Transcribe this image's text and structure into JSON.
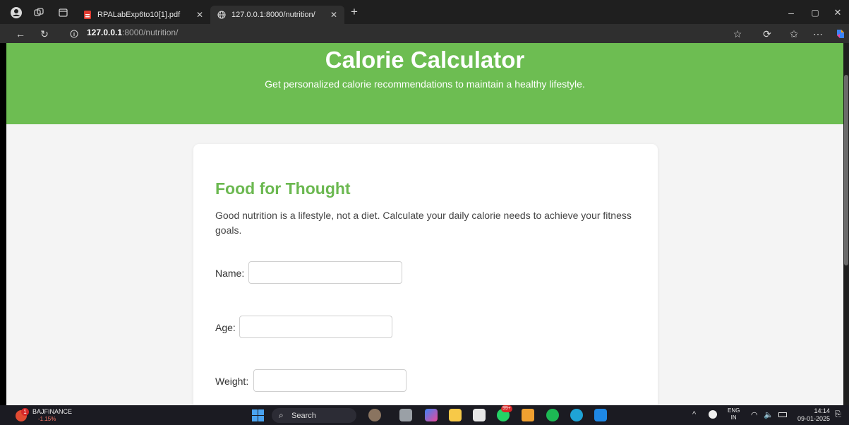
{
  "browser": {
    "tabs": [
      {
        "title": "RPALabExp6to10[1].pdf"
      },
      {
        "title": "127.0.0.1:8000/nutrition/"
      }
    ],
    "new_tab": "+",
    "url_host": "127.0.0.1",
    "url_path": ":8000/nutrition/",
    "window_controls": {
      "minimize": "–",
      "restore": "▢",
      "close": "✕"
    }
  },
  "page": {
    "header_title": "Calorie Calculator",
    "header_subtitle": "Get personalized calorie recommendations to maintain a healthy lifestyle.",
    "card_title": "Food for Thought",
    "card_intro": "Good nutrition is a lifestyle, not a diet. Calculate your daily calorie needs to achieve your fitness goals.",
    "fields": [
      {
        "label": "Name:",
        "value": ""
      },
      {
        "label": "Age:",
        "value": ""
      },
      {
        "label": "Weight:",
        "value": ""
      }
    ]
  },
  "colors": {
    "header_green": "#6dbd52",
    "title_green": "#6bb850"
  },
  "taskbar": {
    "stock_name": "BAJFINANCE",
    "stock_change": "-1.15%",
    "stock_badge": "1",
    "search_label": "Search",
    "whatsapp_badge": "99+",
    "language": "ENG",
    "region": "IN",
    "time": "14:14",
    "date": "09-01-2025"
  }
}
